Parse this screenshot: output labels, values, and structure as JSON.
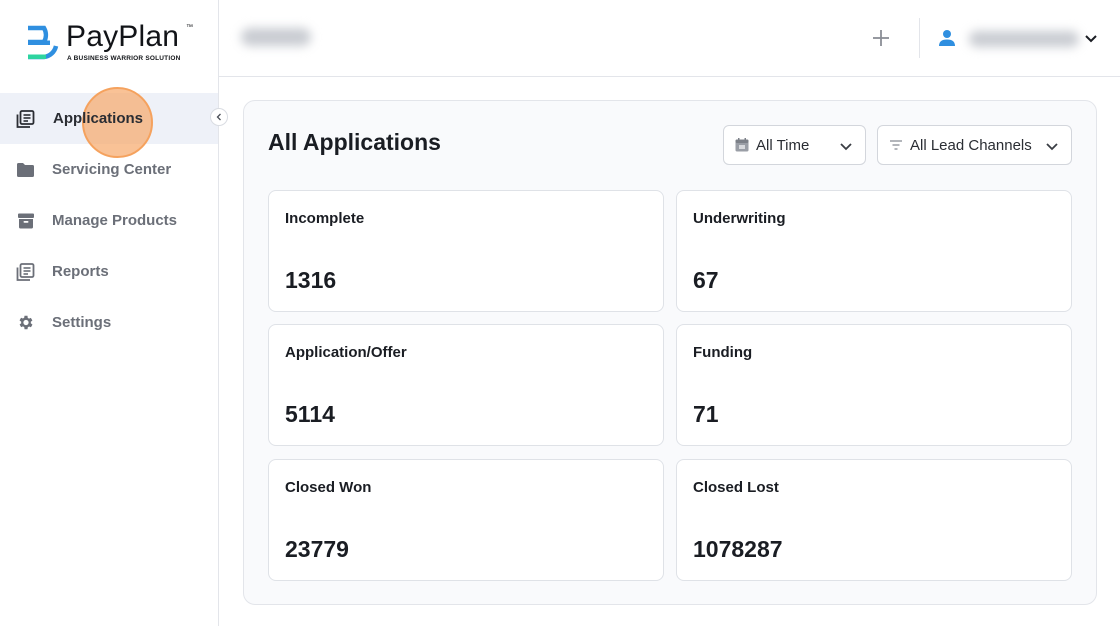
{
  "brand": {
    "name": "PayPlan",
    "trademark": "™",
    "tagline": "A BUSINESS WARRIOR SOLUTION",
    "colors": {
      "mark_top": "#2f8fe0",
      "mark_bottom": "#2dd4a0"
    }
  },
  "sidebar": {
    "items": [
      {
        "label": "Applications",
        "icon": "applications-icon",
        "active": true
      },
      {
        "label": "Servicing Center",
        "icon": "folder-icon",
        "active": false
      },
      {
        "label": "Manage Products",
        "icon": "archive-box-icon",
        "active": false
      },
      {
        "label": "Reports",
        "icon": "reports-icon",
        "active": false
      },
      {
        "label": "Settings",
        "icon": "gear-icon",
        "active": false
      }
    ]
  },
  "header": {
    "user_icon_color": "#2f8fe0"
  },
  "main": {
    "title": "All Applications",
    "filters": {
      "time": "All Time",
      "channel": "All Lead Channels"
    },
    "cards": [
      {
        "label": "Incomplete",
        "value": "1316"
      },
      {
        "label": "Underwriting",
        "value": "67"
      },
      {
        "label": "Application/Offer",
        "value": "5114"
      },
      {
        "label": "Funding",
        "value": "71"
      },
      {
        "label": "Closed Won",
        "value": "23779"
      },
      {
        "label": "Closed Lost",
        "value": "1078287"
      }
    ]
  }
}
